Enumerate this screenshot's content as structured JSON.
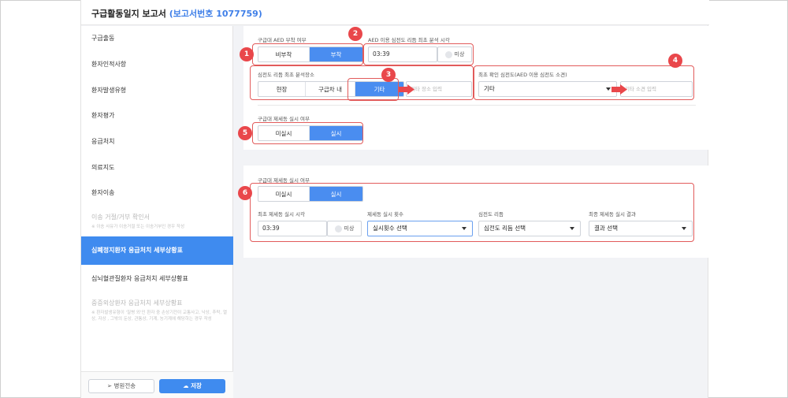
{
  "header": {
    "title": "구급활동일지 보고서",
    "report": "(보고서번호 1077759)"
  },
  "sidebar": {
    "items": [
      {
        "label": "구급출동"
      },
      {
        "label": "환자인적사항"
      },
      {
        "label": "환자발생유형"
      },
      {
        "label": "환자평가"
      },
      {
        "label": "응급처치"
      },
      {
        "label": "의료지도"
      },
      {
        "label": "환자이송"
      },
      {
        "label": "이송 거절/거부 확인서",
        "note": "※ 이송 사유가 이송거절 또는 이송거부인 경우 작성"
      },
      {
        "label": "심폐정지환자 응급처치 세부상황표"
      },
      {
        "label": "심뇌혈관질환자 응급처치 세부상황표"
      },
      {
        "label": "중증외상환자 응급처치 세부상황표",
        "note": "※ 환자발생유형이 '질병 외'인 환자 중 손상기전이 교통사고, 낙상, 추락, 열상, 자상 , 그밖의 둔상, 관통상, 기계, 농기계에 해당하는 경우 작성"
      }
    ],
    "send_label": "병원전송",
    "save_label": "저장"
  },
  "section1": {
    "aed_label": "구급대 AED 부착 여부",
    "aed_options": [
      "비부착",
      "부착"
    ],
    "aed_selected": "부착",
    "analysis_time_label": "AED 이용 심전도 리듬 최초 분석 시각",
    "analysis_time_value": "03:39",
    "unknown_label": "미상",
    "location_label": "심전도 리듬 최초 분석장소",
    "location_options": [
      "현장",
      "구급차 내",
      "기타"
    ],
    "location_selected": "기타",
    "location_other_placeholder": "기타 장소 입력",
    "rhythm_label": "최초 확인 심전도(AED 이용 심전도 소견)",
    "rhythm_value": "기타",
    "rhythm_other_placeholder": "기타 소견 입력",
    "defib_label": "구급대 제세동 실시 여부",
    "defib_options": [
      "미실시",
      "실시"
    ],
    "defib_selected": "실시"
  },
  "section2": {
    "defib_label": "구급대 제세동 실시 여부",
    "defib_options": [
      "미실시",
      "실시"
    ],
    "defib_selected": "실시",
    "first_time_label": "최초 제세동 실시 시각",
    "first_time_value": "03:39",
    "unknown_label": "미상",
    "count_label": "제세동 실시 횟수",
    "count_value": "실시횟수 선택",
    "rhythm_label": "심전도 리듬",
    "rhythm_value": "심전도 리듬 선택",
    "result_label": "최종 제세동 실시 결과",
    "result_value": "결과 선택"
  },
  "badges": [
    "1",
    "2",
    "3",
    "4",
    "5",
    "6"
  ],
  "colors": {
    "accent": "#4a8df0",
    "annotation": "#e25b5b",
    "badge": "#e9474b"
  }
}
